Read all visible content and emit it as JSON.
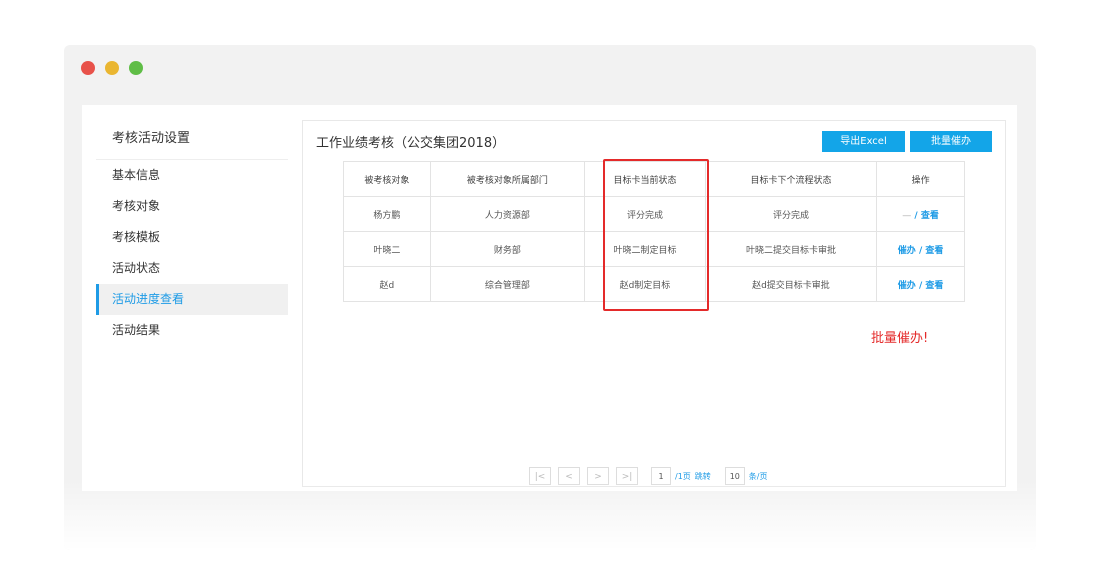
{
  "sidebar": {
    "title": "考核活动设置",
    "items": [
      "基本信息",
      "考核对象",
      "考核模板",
      "活动状态",
      "活动进度查看",
      "活动结果"
    ]
  },
  "main": {
    "title": "工作业绩考核（公交集团2018）",
    "export_label": "导出Excel",
    "batch_label": "批量催办"
  },
  "table": {
    "headers": [
      "被考核对象",
      "被考核对象所属部门",
      "目标卡当前状态",
      "目标卡下个流程状态",
      "操作"
    ],
    "rows": [
      {
        "name": "杨方鹏",
        "dept": "人力资源部",
        "status": "评分完成",
        "next": "评分完成",
        "urge": "—",
        "sep": " / ",
        "view": "查看"
      },
      {
        "name": "叶晓二",
        "dept": "财务部",
        "status": "叶晓二制定目标",
        "next": "叶晓二提交目标卡审批",
        "urge": "催办",
        "sep": " / ",
        "view": "查看"
      },
      {
        "name": "赵d",
        "dept": "综合管理部",
        "status": "赵d制定目标",
        "next": "赵d提交目标卡审批",
        "urge": "催办",
        "sep": " / ",
        "view": "查看"
      }
    ]
  },
  "annotation": "批量催办!",
  "pager": {
    "first": "|<",
    "prev": "<",
    "next": ">",
    "last": ">|",
    "page": "1",
    "total": "/1页",
    "jump": "跳转",
    "size": "10",
    "unit": "条/页"
  },
  "colors": {
    "accent": "#1e9be6",
    "button": "#13a5e8",
    "highlight": "#e42a2a",
    "dot_red": "#e8524a",
    "dot_yellow": "#eab631",
    "dot_green": "#5fbd46"
  }
}
